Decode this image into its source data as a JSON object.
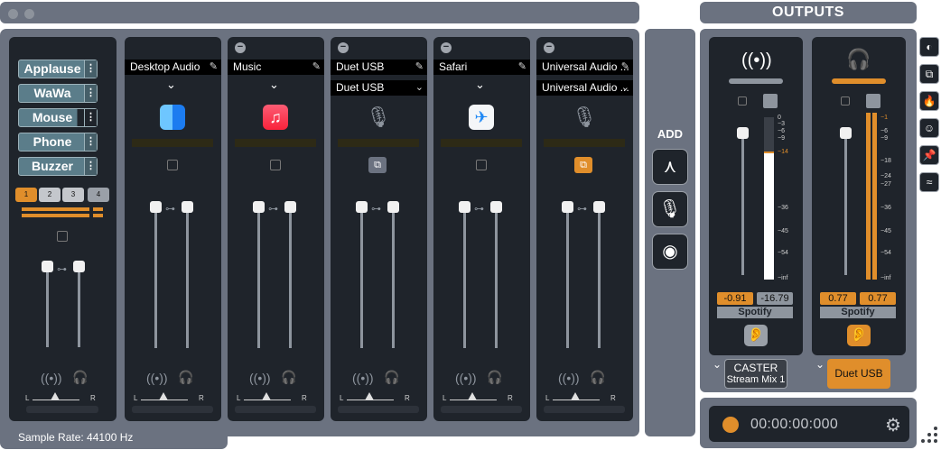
{
  "window": {
    "title": ""
  },
  "main": {
    "sample_rate": "Sample Rate: 44100 Hz"
  },
  "sound_pad": {
    "buttons": [
      {
        "label": "Applause"
      },
      {
        "label": "WaWa"
      },
      {
        "label": "Mouse"
      },
      {
        "label": "Phone"
      },
      {
        "label": "Buzzer"
      }
    ],
    "banks": [
      "1",
      "2",
      "3",
      "4"
    ],
    "active_bank": "1",
    "pan": {
      "left": "L",
      "right": "R"
    }
  },
  "sources": [
    {
      "name": "Desktop Audio",
      "icon": "finder-icon",
      "removable": false,
      "route_style": "plain",
      "muted": false
    },
    {
      "name": "Music",
      "icon": "music-icon",
      "removable": true,
      "route_style": "plain",
      "muted": false
    },
    {
      "name": "Duet USB",
      "sub": "Duet USB",
      "icon": "microphone-icon",
      "removable": true,
      "route_style": "grey",
      "muted": true
    },
    {
      "name": "Safari",
      "icon": "safari-icon",
      "removable": true,
      "route_style": "plain",
      "muted": false
    },
    {
      "name": "Universal Audio ...",
      "sub": "Universal Audio ...",
      "icon": "microphone-icon",
      "removable": true,
      "route_style": "orange",
      "muted": true
    }
  ],
  "pan_labels": {
    "left": "L",
    "right": "R"
  },
  "add": {
    "label": "ADD"
  },
  "outputs": {
    "title": "OUTPUTS",
    "channels": [
      {
        "name": "CASTER",
        "sub": "Stream Mix 1",
        "kind": "broadcast",
        "left_value": "-0.91",
        "right_value": "-16.79",
        "source": "Spotify",
        "accent": "#8e959e",
        "active": false
      },
      {
        "name": "Duet USB",
        "sub": "",
        "kind": "headphones",
        "left_value": "0.77",
        "right_value": "0.77",
        "source": "Spotify",
        "accent": "#e08e2b",
        "active": true
      }
    ],
    "scale_a": [
      "0",
      "−3",
      "−6",
      "−9",
      "−14",
      "−36",
      "−45",
      "−54",
      "−inf"
    ],
    "scale_b": [
      "−1",
      "−6",
      "−9",
      "−18",
      "−24",
      "−27",
      "−36",
      "−45",
      "−54",
      "−inf"
    ]
  },
  "recorder": {
    "time": "00:00:00:000"
  },
  "colors": {
    "accent": "#e08e2b",
    "panel": "#6b7280",
    "strip": "#1f242b",
    "sfx": "#5b7d8a"
  }
}
